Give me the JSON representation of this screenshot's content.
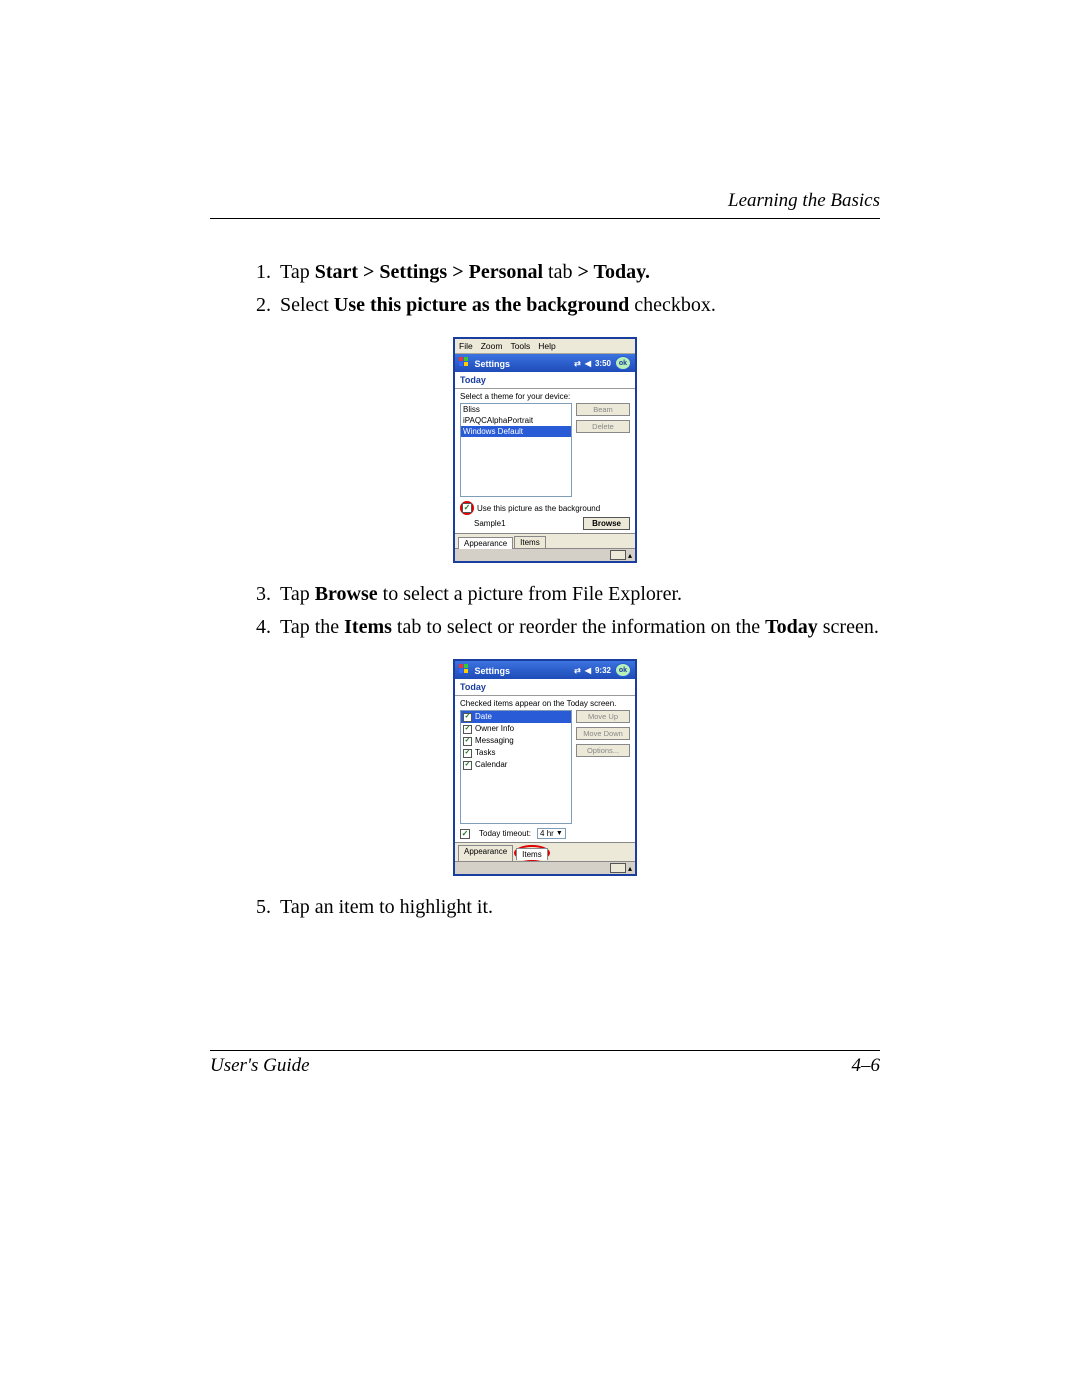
{
  "header": {
    "chapter": "Learning the Basics"
  },
  "steps": {
    "s1_pre": "Tap ",
    "s1_bold": "Start > Settings > Personal ",
    "s1_mid": "tab ",
    "s1_bold2": "> Today.",
    "s2_pre": "Select ",
    "s2_bold": "Use this picture as the background ",
    "s2_post": "checkbox.",
    "s3_pre": "Tap ",
    "s3_bold": "Browse ",
    "s3_post": "to select a picture from File Explorer.",
    "s4_pre": "Tap the ",
    "s4_bold": "Items ",
    "s4_mid": "tab to select or reorder the information on the ",
    "s4_bold2": "Today ",
    "s4_post": "screen.",
    "s5": "Tap an item to highlight it."
  },
  "shot1": {
    "menu": {
      "file": "File",
      "zoom": "Zoom",
      "tools": "Tools",
      "help": "Help"
    },
    "nav": {
      "title": "Settings",
      "time": "3:50",
      "ok": "ok"
    },
    "subtitle": "Today",
    "instruction": "Select a theme for your device:",
    "themes": [
      "Bliss",
      "iPAQCAlphaPortrait",
      "Windows Default"
    ],
    "selected_theme_index": 2,
    "btn_beam": "Beam",
    "btn_delete": "Delete",
    "cb_label": "Use this picture as the background",
    "sample_label": "Sample1",
    "btn_browse": "Browse",
    "tab_appearance": "Appearance",
    "tab_items": "Items"
  },
  "shot2": {
    "nav": {
      "title": "Settings",
      "time": "9:32",
      "ok": "ok"
    },
    "subtitle": "Today",
    "instruction": "Checked items appear on the Today screen.",
    "items": [
      "Date",
      "Owner Info",
      "Messaging",
      "Tasks",
      "Calendar"
    ],
    "selected_item_index": 0,
    "btn_moveup": "Move Up",
    "btn_movedown": "Move Down",
    "btn_options": "Options...",
    "timeout_label": "Today timeout:",
    "timeout_value": "4 hr",
    "tab_appearance": "Appearance",
    "tab_items": "Items"
  },
  "footer": {
    "left": "User's Guide",
    "right": "4–6"
  }
}
